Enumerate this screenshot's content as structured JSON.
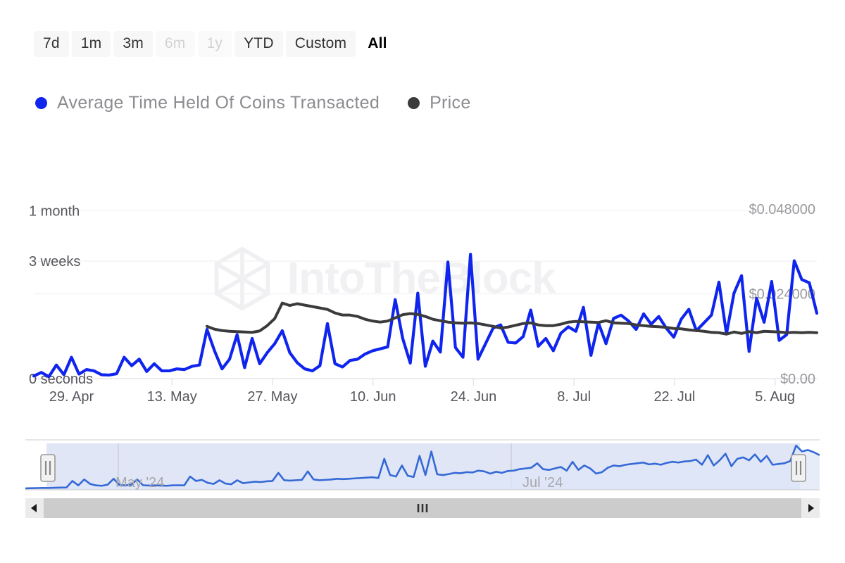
{
  "range_selector": {
    "buttons": [
      {
        "label": "7d",
        "state": "normal"
      },
      {
        "label": "1m",
        "state": "normal"
      },
      {
        "label": "3m",
        "state": "normal"
      },
      {
        "label": "6m",
        "state": "disabled"
      },
      {
        "label": "1y",
        "state": "disabled"
      },
      {
        "label": "YTD",
        "state": "normal"
      },
      {
        "label": "Custom",
        "state": "normal"
      },
      {
        "label": "All",
        "state": "selected"
      }
    ]
  },
  "legend": {
    "items": [
      {
        "label": "Average Time Held Of Coins Transacted",
        "color": "#0f25ee",
        "icon": "legend-dot-icon"
      },
      {
        "label": "Price",
        "color": "#3b3b3d",
        "icon": "legend-dot-icon"
      }
    ]
  },
  "watermark": {
    "text": "IntoTheBlock",
    "logo": "hexagon-logo-icon"
  },
  "navigator": {
    "labels": [
      "May '24",
      "Jul '24"
    ],
    "left_handle": "nav-handle-left",
    "right_handle": "nav-handle-right"
  },
  "scrollbar": {
    "left_arrow": "scroll-left-arrow-icon",
    "right_arrow": "scroll-right-arrow-icon",
    "grip": "scroll-grip-icon"
  },
  "chart_data": {
    "type": "line",
    "title": "",
    "xlabel": "",
    "ylabel": "Average Time Held Of Coins Transacted",
    "y2label": "Price",
    "grid": true,
    "legend_position": "top-left",
    "x_tick_labels": [
      "29. Apr",
      "13. May",
      "27. May",
      "10. Jun",
      "24. Jun",
      "8. Jul",
      "22. Jul",
      "5. Aug"
    ],
    "y_left_tick_labels": [
      "0 seconds",
      "3 weeks",
      "1 month"
    ],
    "y_left_tick_values": [
      0,
      1814400,
      2592000
    ],
    "y_left_range": [
      0,
      2880000
    ],
    "y_right_tick_labels": [
      "$0.00",
      "$0.024000",
      "$0.048000"
    ],
    "y_right_tick_values": [
      0,
      0.024,
      0.048
    ],
    "y_right_range": [
      0,
      0.0528
    ],
    "series": [
      {
        "name": "Average Time Held Of Coins Transacted",
        "color": "#0f25ee",
        "axis": "left",
        "unit": "seconds",
        "values": [
          40000,
          95000,
          30000,
          210000,
          60000,
          330000,
          70000,
          140000,
          120000,
          60000,
          55000,
          75000,
          330000,
          200000,
          300000,
          110000,
          230000,
          120000,
          120000,
          150000,
          140000,
          190000,
          210000,
          760000,
          430000,
          150000,
          300000,
          680000,
          170000,
          620000,
          230000,
          400000,
          540000,
          740000,
          400000,
          245000,
          150000,
          120000,
          200000,
          850000,
          230000,
          180000,
          280000,
          300000,
          380000,
          430000,
          460000,
          490000,
          1220000,
          620000,
          240000,
          1320000,
          190000,
          580000,
          410000,
          1800000,
          480000,
          330000,
          1920000,
          300000,
          540000,
          780000,
          830000,
          560000,
          550000,
          650000,
          1060000,
          500000,
          620000,
          430000,
          700000,
          800000,
          730000,
          1100000,
          360000,
          860000,
          540000,
          930000,
          980000,
          890000,
          760000,
          1000000,
          840000,
          960000,
          780000,
          640000,
          920000,
          1070000,
          740000,
          860000,
          980000,
          1490000,
          690000,
          1320000,
          1590000,
          420000,
          1240000,
          870000,
          1500000,
          590000,
          680000,
          1820000,
          1530000,
          1480000,
          1010000
        ]
      },
      {
        "name": "Price",
        "color": "#3b3b3d",
        "axis": "right",
        "unit": "USD",
        "values": [
          null,
          null,
          null,
          null,
          null,
          null,
          null,
          null,
          null,
          null,
          null,
          null,
          null,
          null,
          null,
          null,
          null,
          null,
          null,
          null,
          null,
          null,
          null,
          0.0148,
          0.014,
          0.0136,
          0.0134,
          0.0133,
          0.0132,
          0.0131,
          0.0135,
          0.015,
          0.017,
          0.0214,
          0.0207,
          0.0212,
          0.0208,
          0.0204,
          0.02,
          0.0196,
          0.0186,
          0.018,
          0.018,
          0.0176,
          0.0168,
          0.0163,
          0.016,
          0.0163,
          0.0172,
          0.0181,
          0.0184,
          0.0182,
          0.0176,
          0.0168,
          0.0164,
          0.016,
          0.0158,
          0.0157,
          0.0158,
          0.0156,
          0.0152,
          0.0148,
          0.0143,
          0.0146,
          0.0151,
          0.0156,
          0.0158,
          0.0152,
          0.015,
          0.015,
          0.0154,
          0.016,
          0.0162,
          0.0161,
          0.016,
          0.0159,
          0.0164,
          0.0158,
          0.0157,
          0.0156,
          0.0152,
          0.015,
          0.0148,
          0.0147,
          0.0145,
          0.0142,
          0.0141,
          0.0138,
          0.0136,
          0.0134,
          0.0131,
          0.013,
          0.0126,
          0.0132,
          0.0128,
          0.0133,
          0.013,
          0.0134,
          0.0133,
          0.0132,
          0.013,
          0.0131,
          0.013,
          0.0131,
          0.013
        ]
      }
    ],
    "navigator_series": {
      "name": "Average Time Held Of Coins Transacted",
      "color": "#3569d6",
      "values": [
        20000,
        22000,
        24000,
        26000,
        25000,
        28000,
        30000,
        32000,
        120000,
        60000,
        140000,
        80000,
        60000,
        55000,
        70000,
        150000,
        65000,
        60000,
        70000,
        140000,
        62000,
        58000,
        60000,
        58000,
        55000,
        60000,
        62000,
        60000,
        180000,
        120000,
        135000,
        95000,
        80000,
        130000,
        85000,
        75000,
        130000,
        90000,
        100000,
        110000,
        105000,
        115000,
        120000,
        230000,
        130000,
        125000,
        130000,
        135000,
        250000,
        140000,
        130000,
        135000,
        140000,
        150000,
        145000,
        150000,
        155000,
        160000,
        165000,
        170000,
        160000,
        420000,
        200000,
        180000,
        330000,
        190000,
        175000,
        460000,
        200000,
        520000,
        210000,
        200000,
        215000,
        230000,
        225000,
        240000,
        235000,
        260000,
        250000,
        220000,
        245000,
        230000,
        255000,
        260000,
        280000,
        290000,
        300000,
        360000,
        280000,
        270000,
        290000,
        310000,
        260000,
        380000,
        270000,
        330000,
        290000,
        220000,
        240000,
        300000,
        330000,
        320000,
        340000,
        350000,
        360000,
        370000,
        345000,
        355000,
        340000,
        365000,
        380000,
        370000,
        385000,
        390000,
        410000,
        340000,
        470000,
        330000,
        400000,
        490000,
        320000,
        420000,
        440000,
        400000,
        480000,
        380000,
        460000,
        340000,
        350000,
        360000,
        390000,
        600000,
        520000,
        540000,
        510000,
        470000
      ]
    }
  }
}
